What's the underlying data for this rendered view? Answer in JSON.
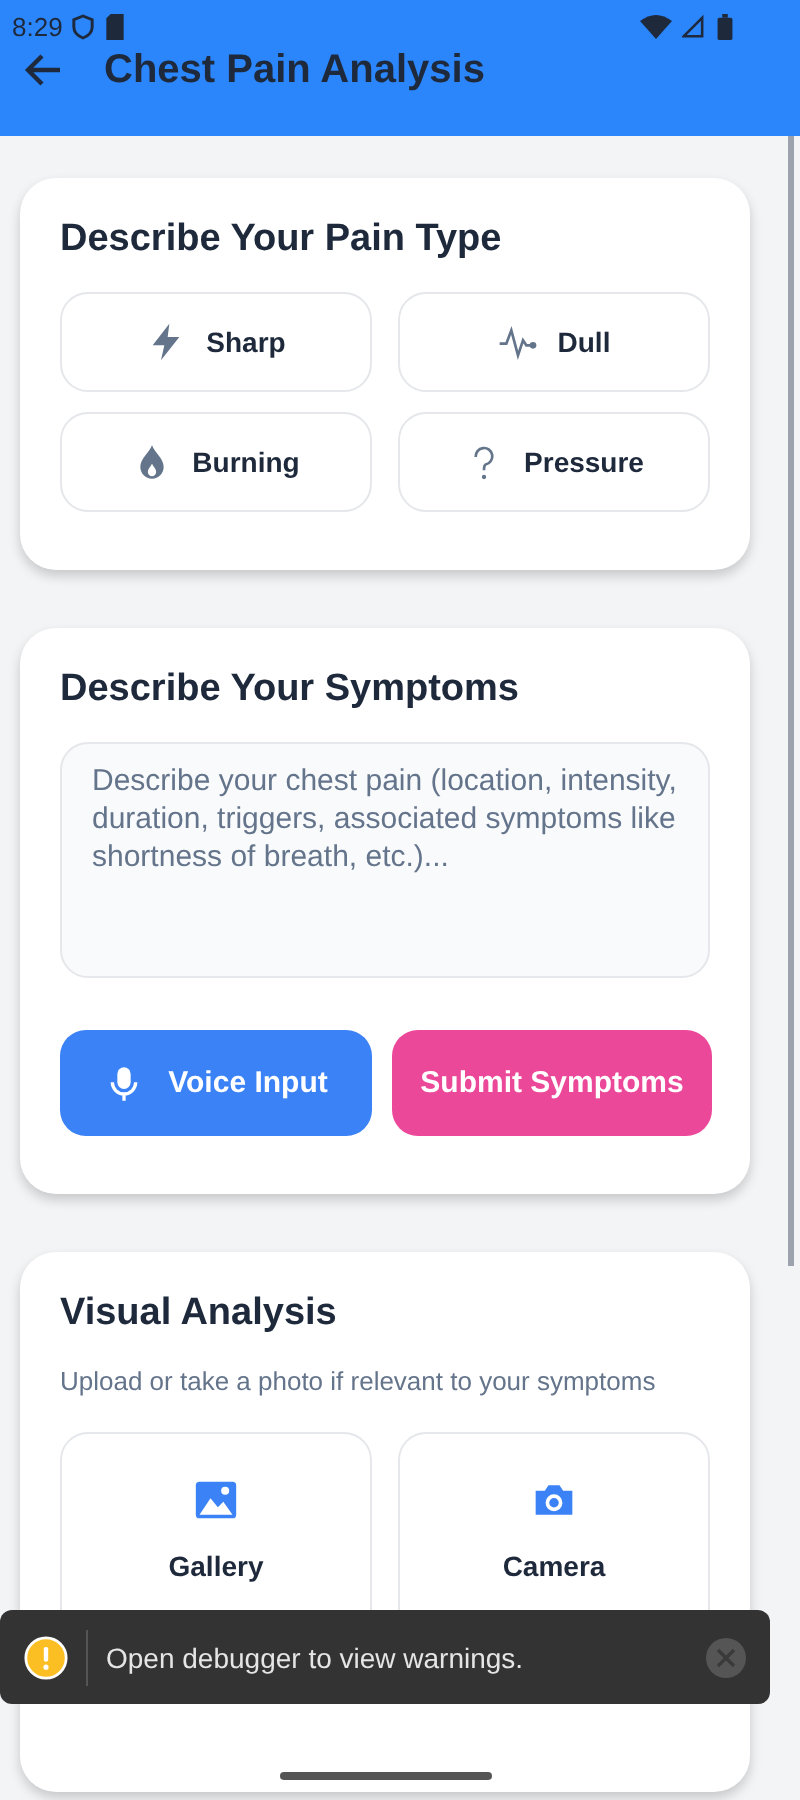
{
  "status_bar": {
    "time": "8:29"
  },
  "app_bar": {
    "title": "Chest Pain Analysis"
  },
  "pain_type": {
    "title": "Describe Your Pain Type",
    "options": [
      {
        "label": "Sharp",
        "kind": "bolt"
      },
      {
        "label": "Dull",
        "kind": "pulse"
      },
      {
        "label": "Burning",
        "kind": "flame"
      },
      {
        "label": "Pressure",
        "kind": "question"
      }
    ]
  },
  "symptoms": {
    "title": "Describe Your Symptoms",
    "placeholder": "Describe your chest pain (location, intensity, duration, triggers, associated symptoms like shortness of breath, etc.)...",
    "voice_button": "Voice Input",
    "submit_button": "Submit Symptoms"
  },
  "visual": {
    "title": "Visual Analysis",
    "subtitle": "Upload or take a photo if relevant to your symptoms",
    "options": [
      {
        "label": "Gallery",
        "kind": "gallery"
      },
      {
        "label": "Camera",
        "kind": "camera"
      }
    ]
  },
  "toast": {
    "message": "Open debugger to view warnings."
  }
}
